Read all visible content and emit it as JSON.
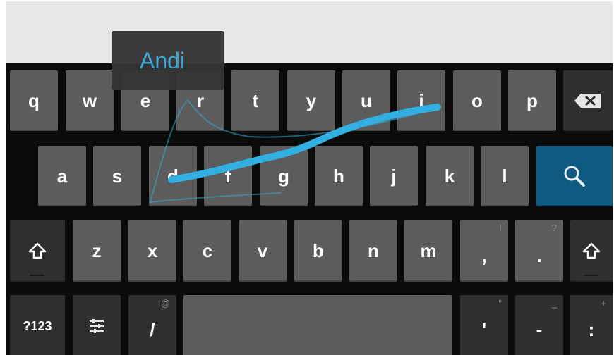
{
  "suggestion": {
    "word": "Andi"
  },
  "keyboard": {
    "row1": [
      "q",
      "w",
      "e",
      "r",
      "t",
      "y",
      "u",
      "i",
      "o",
      "p"
    ],
    "row2": [
      "a",
      "s",
      "d",
      "f",
      "g",
      "h",
      "j",
      "k",
      "l"
    ],
    "row3": [
      "z",
      "x",
      "c",
      "v",
      "b",
      "n",
      "m"
    ],
    "row3_comma": {
      "label": ",",
      "alt": "!"
    },
    "row3_period": {
      "label": ".",
      "alt": "?"
    },
    "row4": {
      "symbols_label": "?123",
      "slash": {
        "label": "/",
        "alt": "@"
      },
      "apostrophe": {
        "label": "'",
        "alt": "\""
      },
      "dash": {
        "label": "-",
        "alt": "_"
      },
      "colon": {
        "label": ":",
        "alt": "+"
      }
    }
  },
  "icons": {
    "backspace": "backspace-icon",
    "search": "search-icon",
    "shift": "shift-icon",
    "settings": "settings-sliders-icon"
  },
  "colors": {
    "key": "#5c5c5c",
    "key_dark": "#2f2f2f",
    "accent": "#0f5a80",
    "trail": "#33aee0",
    "suggestion_text": "#39a9d8"
  }
}
